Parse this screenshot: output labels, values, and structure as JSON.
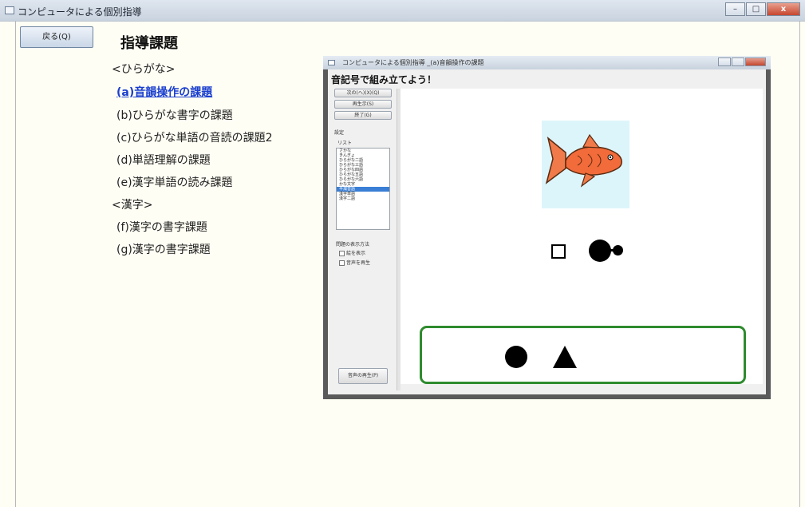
{
  "window": {
    "title": "コンピュータによる個別指導",
    "controls": {
      "minimize": "–",
      "maximize": "□",
      "close": "x"
    }
  },
  "back_button": {
    "label": "戻る(Q)"
  },
  "heading": "指導課題",
  "menu": {
    "hiragana_header": "<ひらがな>",
    "items_hiragana": [
      "(a)音韻操作の課題",
      "(b)ひらがな書字の課題",
      "(c)ひらがな単語の音読の課題2",
      "(d)単語理解の課題",
      "(e)漢字単語の読み課題"
    ],
    "kanji_header": "<漢字>",
    "items_kanji": [
      "(f)漢字の書字課題",
      "(g)漢字の書字課題"
    ]
  },
  "inner_window": {
    "title": "コンピュータによる個別指導 _(a)音韻操作の課題",
    "task_title": "音記号で組み立てよう！",
    "buttons": [
      "次の(へ)(X)(Q)",
      "再生示(S)",
      "終了(G)"
    ],
    "settings_label": "設定",
    "list_label": "リスト",
    "list_items": [
      "さかな",
      "きんぎょ",
      "ひらがな二語",
      "ひらがな三語",
      "ひらがな四語",
      "ひらがな五語",
      "ひらがな六語",
      "かな文字",
      "半濁音語",
      "漢字単語",
      "漢字二語"
    ],
    "selected_index": 8,
    "options_label": "問題の表示方法",
    "options": [
      "絵を表示",
      "音声を再生"
    ],
    "bottom_button": "音声の再生(P)"
  }
}
